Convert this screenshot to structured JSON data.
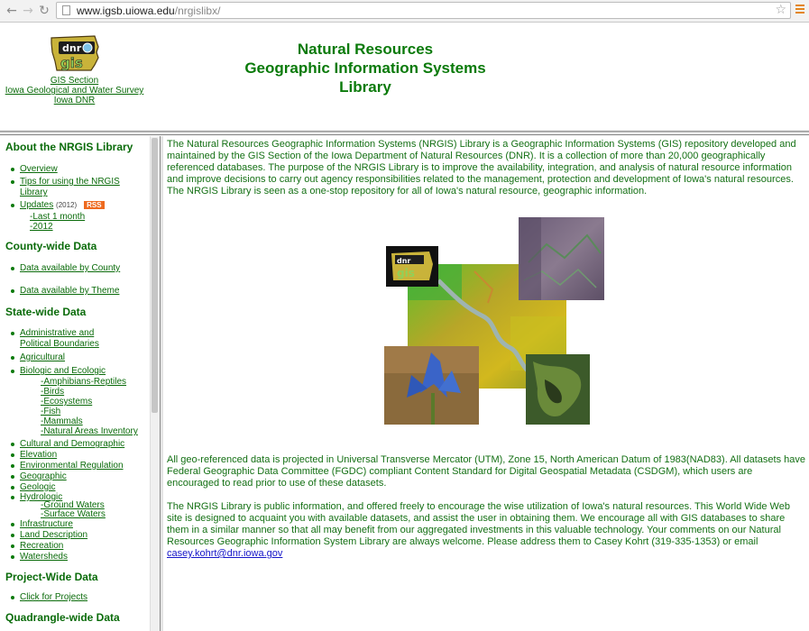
{
  "browser": {
    "url_host": "www.igsb.uiowa.edu",
    "url_path": "/nrgislibx/"
  },
  "header": {
    "title_line1": "Natural Resources",
    "title_line2": "Geographic Information Systems",
    "title_line3": "Library",
    "logo_text_top": "dnr",
    "logo_text_bottom": "gis",
    "links": [
      "GIS Section",
      "Iowa Geological and Water Survey",
      "Iowa DNR"
    ]
  },
  "sidebar": {
    "about_heading": "About the NRGIS Library",
    "overview": "Overview",
    "tips": "Tips for using the NRGIS Library",
    "updates": "Updates",
    "updates_year": "(2012)",
    "rss": "RSS",
    "last_month": "-Last 1 month",
    "year_2012": "-2012",
    "county_heading": "County-wide Data",
    "by_county": "Data available by County",
    "by_theme": "Data available by Theme",
    "state_heading": "State-wide Data",
    "state_items": {
      "admin": "Administrative and Political Boundaries",
      "agri": "Agricultural",
      "bio": "Biologic and Ecologic",
      "cultural": "Cultural and Demographic",
      "elevation": "Elevation",
      "environmental": "Environmental Regulation",
      "geographic": "Geographic",
      "geologic": "Geologic",
      "hydrologic": "Hydrologic",
      "infrastructure": "Infrastructure",
      "land": "Land Description",
      "recreation": "Recreation",
      "watersheds": "Watersheds"
    },
    "bio_sub": [
      "-Amphibians-Reptiles",
      "-Birds",
      "-Ecosystems",
      "-Fish",
      "-Mammals",
      "-Natural Areas Inventory"
    ],
    "hydro_sub": [
      "-Ground Waters",
      "-Surface Waters"
    ],
    "project_heading": "Project-Wide Data",
    "click_projects": "Click for Projects",
    "quad_heading": "Quadrangle-wide Data"
  },
  "main": {
    "p1": "The Natural Resources Geographic Information Systems (NRGIS) Library is a Geographic Information Systems (GIS) repository developed and maintained by the GIS Section of the Iowa Department of Natural Resources (DNR).  It is a collection of more than 20,000 geographically referenced databases.  The purpose of the NRGIS Library is to improve the availability, integration, and analysis of natural resource information and improve decisions to carry out agency responsibilities related to the management, protection and development of Iowa's natural resources.  The NRGIS Library is seen as a one-stop repository for all of Iowa's natural resource, geographic information.",
    "p2": "All geo-referenced data is projected in Universal Transverse Mercator (UTM), Zone 15, North American Datum of 1983(NAD83).  All datasets have Federal Geographic Data Committee (FGDC)  compliant Content Standard for Digital Geospatial Metadata (CSDGM), which users are encouraged to read prior to use of these datasets.",
    "p3": "The NRGIS Library is public information, and offered freely to encourage the wise utilization of Iowa's natural resources.  This World Wide Web site is designed to acquaint you with available datasets, and assist  the user in obtaining them. We encourage all with GIS databases to share them in a similar manner so that all may benefit from our aggregated investments in this valuable technology. Your comments on our Natural Resources Geographic Information System Library are always welcome. Please address them to Casey Kohrt (319-335-1353) or email",
    "email": "casey.kohrt@dnr.iowa.gov"
  }
}
